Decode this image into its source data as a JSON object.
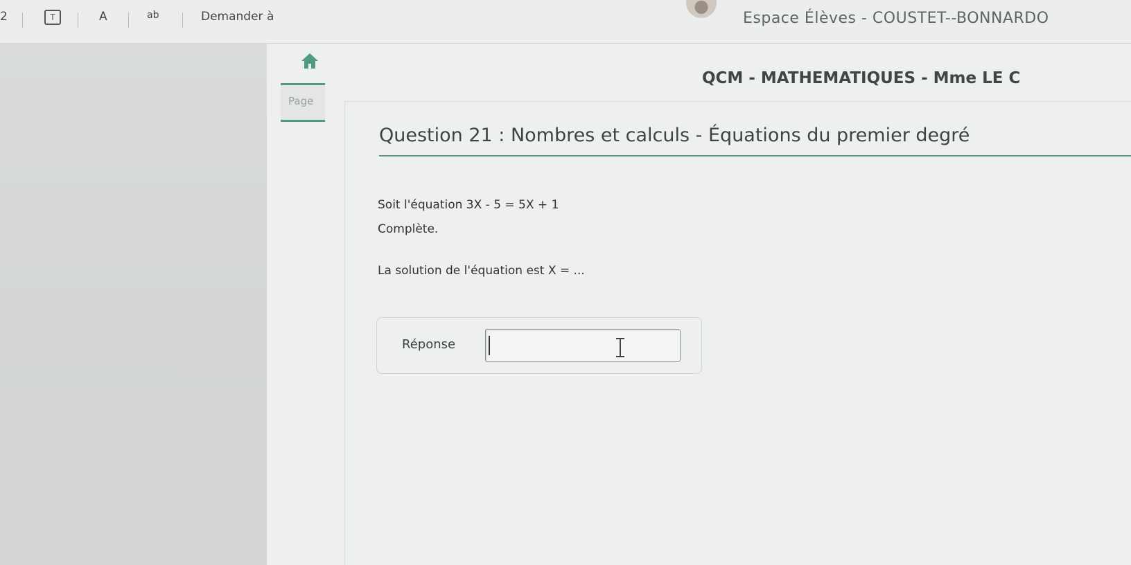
{
  "toolbar": {
    "item1": "2",
    "item2": "T",
    "item3": "A",
    "item4": "ab",
    "ask_label": "Demander à"
  },
  "header": {
    "space_title": "Espace Élèves - COUSTET--BONNARDO",
    "qcm_title": "QCM - MATHEMATIQUES - Mme LE C"
  },
  "nav": {
    "page_tab": "Page"
  },
  "question": {
    "title": "Question 21 : Nombres et calculs - Équations du premier degré",
    "line1": "Soit l'équation 3X - 5 = 5X + 1",
    "line2": "Complète.",
    "line3": "La solution de l'équation est X = ..."
  },
  "answer": {
    "label": "Réponse",
    "value": ""
  },
  "colors": {
    "accent": "#4f9b7f",
    "text": "#3c4446"
  }
}
